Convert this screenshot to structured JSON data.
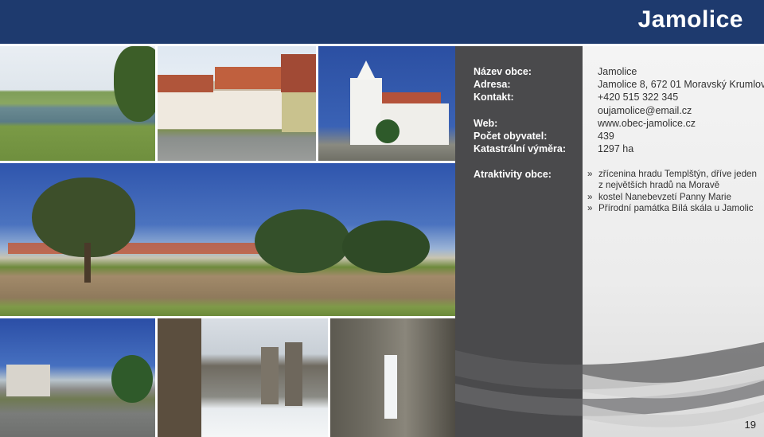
{
  "header": {
    "title": "Jamolice"
  },
  "info": {
    "labels": {
      "name": "Název obce:",
      "address": "Adresa:",
      "contact": "Kontakt:",
      "web": "Web:",
      "population": "Počet obyvatel:",
      "area": "Katastrální výměra:"
    },
    "values": {
      "name": "Jamolice",
      "address": "Jamolice 8, 672 01 Moravský Krumlov",
      "phone": "+420 515 322 345",
      "email": "oujamolice@email.cz",
      "web": "www.obec-jamolice.cz",
      "population": "439",
      "area": "1297 ha"
    }
  },
  "attractions": {
    "label": "Atraktivity obce:",
    "items": [
      "zřícenina hradu Templštýn, dříve jeden z největších hradů na Moravě",
      "kostel Nanebevzetí Panny Marie",
      "Přírodní památka Bílá skála u Jamolic"
    ]
  },
  "footer": {
    "page_number": "19"
  },
  "colors": {
    "header": "#1e3a6e",
    "dark_column": "#4a4a4c",
    "panel": "#ececec"
  }
}
